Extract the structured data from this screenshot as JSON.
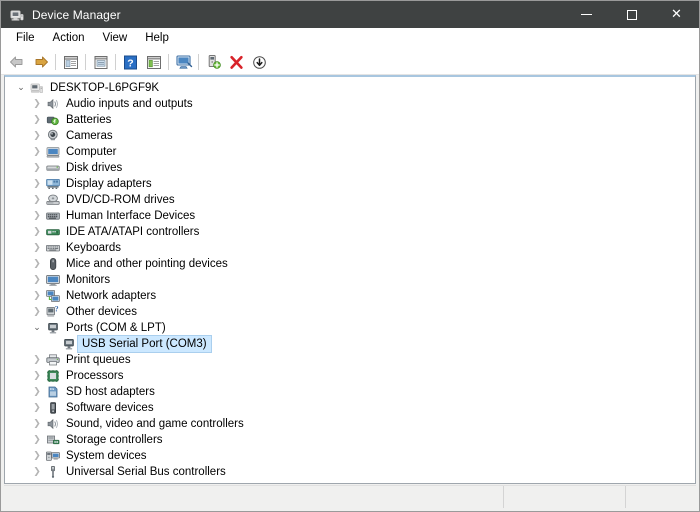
{
  "window": {
    "title": "Device Manager",
    "app_icon": "device-manager-icon",
    "controls": {
      "minimize": "minimize-icon",
      "maximize": "maximize-icon",
      "close": "close-icon"
    }
  },
  "menu": {
    "items": [
      {
        "label": "File",
        "name": "menu-file"
      },
      {
        "label": "Action",
        "name": "menu-action"
      },
      {
        "label": "View",
        "name": "menu-view"
      },
      {
        "label": "Help",
        "name": "menu-help"
      }
    ]
  },
  "toolbar": {
    "buttons": [
      {
        "name": "back-button",
        "icon": "back-arrow-icon"
      },
      {
        "name": "forward-button",
        "icon": "forward-arrow-icon"
      },
      {
        "name": "separator-1",
        "icon": "separator"
      },
      {
        "name": "properties-button",
        "icon": "properties-icon"
      },
      {
        "name": "separator-2",
        "icon": "separator"
      },
      {
        "name": "update-driver-button",
        "icon": "update-driver-icon"
      },
      {
        "name": "separator-3",
        "icon": "separator"
      },
      {
        "name": "help-button",
        "icon": "help-question-icon"
      },
      {
        "name": "show-hidden-button",
        "icon": "show-hidden-devices-icon"
      },
      {
        "name": "separator-4",
        "icon": "separator"
      },
      {
        "name": "scan-hardware-button",
        "icon": "scan-monitor-icon"
      },
      {
        "name": "separator-5",
        "icon": "separator"
      },
      {
        "name": "add-legacy-hardware-button",
        "icon": "add-hardware-icon"
      },
      {
        "name": "uninstall-device-button",
        "icon": "red-x-icon"
      },
      {
        "name": "disable-device-button",
        "icon": "down-arrow-circle-icon"
      }
    ]
  },
  "tree": {
    "root": {
      "label": "DESKTOP-L6PGF9K",
      "icon": "computer-root-icon",
      "expanded": true
    },
    "nodes": [
      {
        "label": "Audio inputs and outputs",
        "icon": "speaker-icon",
        "expanded": false,
        "selected": false
      },
      {
        "label": "Batteries",
        "icon": "battery-icon",
        "expanded": false,
        "selected": false
      },
      {
        "label": "Cameras",
        "icon": "camera-icon",
        "expanded": false,
        "selected": false
      },
      {
        "label": "Computer",
        "icon": "computer-icon",
        "expanded": false,
        "selected": false
      },
      {
        "label": "Disk drives",
        "icon": "disk-drive-icon",
        "expanded": false,
        "selected": false
      },
      {
        "label": "Display adapters",
        "icon": "display-adapter-icon",
        "expanded": false,
        "selected": false
      },
      {
        "label": "DVD/CD-ROM drives",
        "icon": "dvd-drive-icon",
        "expanded": false,
        "selected": false
      },
      {
        "label": "Human Interface Devices",
        "icon": "hid-icon",
        "expanded": false,
        "selected": false
      },
      {
        "label": "IDE ATA/ATAPI controllers",
        "icon": "ide-controller-icon",
        "expanded": false,
        "selected": false
      },
      {
        "label": "Keyboards",
        "icon": "keyboard-icon",
        "expanded": false,
        "selected": false
      },
      {
        "label": "Mice and other pointing devices",
        "icon": "mouse-icon",
        "expanded": false,
        "selected": false
      },
      {
        "label": "Monitors",
        "icon": "monitor-icon",
        "expanded": false,
        "selected": false
      },
      {
        "label": "Network adapters",
        "icon": "network-adapter-icon",
        "expanded": false,
        "selected": false
      },
      {
        "label": "Other devices",
        "icon": "other-devices-icon",
        "expanded": false,
        "selected": false
      },
      {
        "label": "Ports (COM & LPT)",
        "icon": "port-icon",
        "expanded": true,
        "selected": false
      },
      {
        "label": "Print queues",
        "icon": "printer-icon",
        "expanded": false,
        "selected": false
      },
      {
        "label": "Processors",
        "icon": "processor-icon",
        "expanded": false,
        "selected": false
      },
      {
        "label": "SD host adapters",
        "icon": "sd-host-icon",
        "expanded": false,
        "selected": false
      },
      {
        "label": "Software devices",
        "icon": "software-device-icon",
        "expanded": false,
        "selected": false
      },
      {
        "label": "Sound, video and game controllers",
        "icon": "sound-controller-icon",
        "expanded": false,
        "selected": false
      },
      {
        "label": "Storage controllers",
        "icon": "storage-controller-icon",
        "expanded": false,
        "selected": false
      },
      {
        "label": "System devices",
        "icon": "system-device-icon",
        "expanded": false,
        "selected": false
      },
      {
        "label": "Universal Serial Bus controllers",
        "icon": "usb-controller-icon",
        "expanded": false,
        "selected": false
      }
    ],
    "child_of_ports": {
      "label": "USB Serial Port (COM3)",
      "icon": "port-icon",
      "selected": true
    }
  },
  "statusbar": {
    "pane1": "",
    "pane2": "",
    "pane3": ""
  },
  "colors": {
    "titlebar": "#3f4242",
    "selection": "#cce8ff",
    "accent_strip": "#a8c6df",
    "window_bg": "#f0f0ef",
    "tree_bg": "#ffffff",
    "red_x": "#d8232a"
  }
}
